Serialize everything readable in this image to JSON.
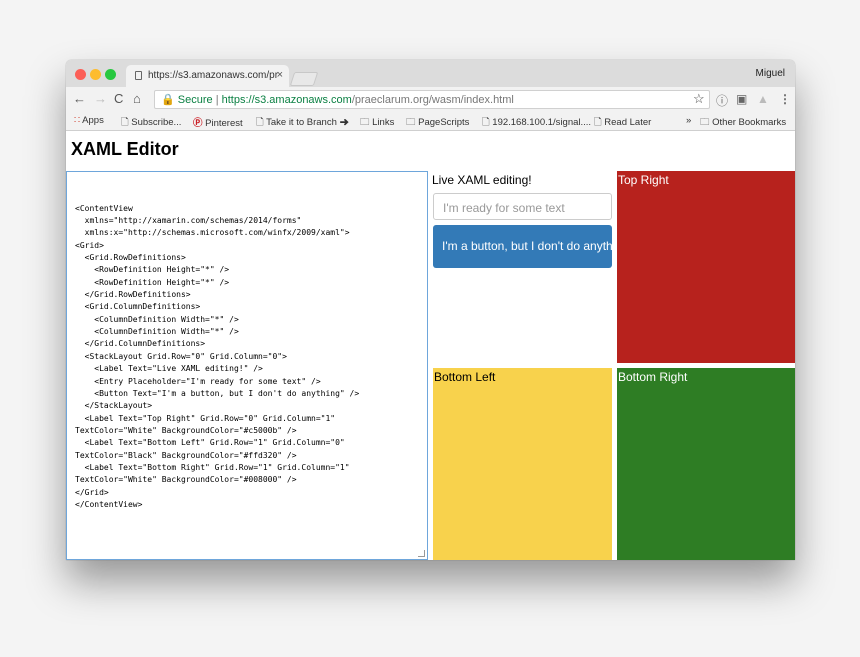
{
  "browser": {
    "tab_title": "https://s3.amazonaws.com/pr",
    "tab_close": "×",
    "user": "Miguel",
    "nav": {
      "back": "←",
      "forward": "→",
      "reload": "C",
      "home": "⌂"
    },
    "address": {
      "secure_label": "Secure",
      "url_scheme_host": "https://s3.amazonaws.com",
      "url_path": "/praeclarum.org/wasm/index.html"
    },
    "icons": {
      "star": "☆",
      "info": "ⓘ",
      "ext1": "▣",
      "ext2": "▲",
      "menu": "⋮"
    },
    "bookmarks": [
      "Apps",
      "Subscribe...",
      "Pinterest",
      "Take it to Branch ➜",
      "Links",
      "PageScripts",
      "192.168.100.1/signal....",
      "Read Later"
    ],
    "bookmarks_overflow": "»",
    "other_bookmarks": "Other Bookmarks"
  },
  "page": {
    "title": "XAML Editor",
    "editor_text": "<ContentView\n  xmlns=\"http://xamarin.com/schemas/2014/forms\"\n  xmlns:x=\"http://schemas.microsoft.com/winfx/2009/xaml\">\n<Grid>\n  <Grid.RowDefinitions>\n    <RowDefinition Height=\"*\" />\n    <RowDefinition Height=\"*\" />\n  </Grid.RowDefinitions>\n  <Grid.ColumnDefinitions>\n    <ColumnDefinition Width=\"*\" />\n    <ColumnDefinition Width=\"*\" />\n  </Grid.ColumnDefinitions>\n  <StackLayout Grid.Row=\"0\" Grid.Column=\"0\">\n    <Label Text=\"Live XAML editing!\" />\n    <Entry Placeholder=\"I'm ready for some text\" />\n    <Button Text=\"I'm a button, but I don't do anything\" />\n  </StackLayout>\n  <Label Text=\"Top Right\" Grid.Row=\"0\" Grid.Column=\"1\"\nTextColor=\"White\" BackgroundColor=\"#c5000b\" />\n  <Label Text=\"Bottom Left\" Grid.Row=\"1\" Grid.Column=\"0\"\nTextColor=\"Black\" BackgroundColor=\"#ffd320\" />\n  <Label Text=\"Bottom Right\" Grid.Row=\"1\" Grid.Column=\"1\"\nTextColor=\"White\" BackgroundColor=\"#008000\" />\n</Grid>\n</ContentView>",
    "preview": {
      "live_label": "Live XAML editing!",
      "entry_placeholder": "I'm ready for some text",
      "button_label": "I'm a button, but I don't do anything",
      "top_right": "Top Right",
      "bottom_left": "Bottom Left",
      "bottom_right": "Bottom Right"
    }
  },
  "colors": {
    "top_right_bg": "#b7221d",
    "bottom_left_bg": "#f8d24c",
    "bottom_right_bg": "#2e7d24",
    "button_bg": "#337ab7",
    "secure_green": "#0b8043"
  }
}
